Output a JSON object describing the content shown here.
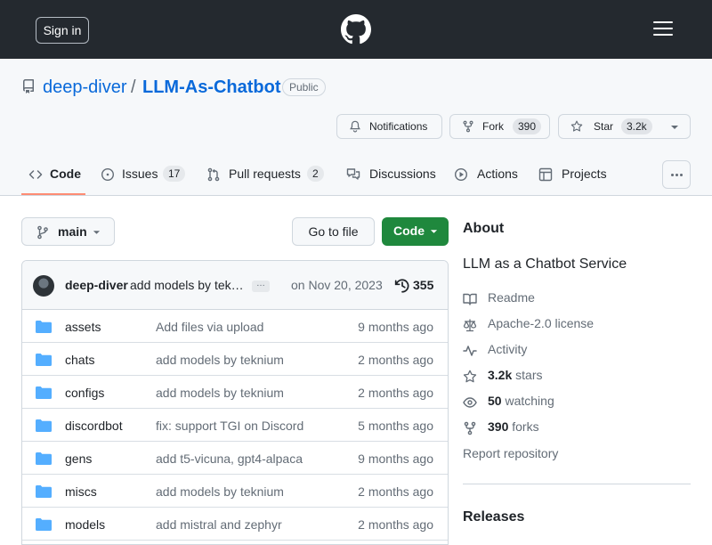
{
  "header": {
    "sign_in_label": "Sign in"
  },
  "repo": {
    "owner": "deep-diver",
    "separator": "/",
    "name": "LLM-As-Chatbot",
    "visibility": "Public",
    "actions": {
      "notifications_label": "Notifications",
      "fork_label": "Fork",
      "fork_count": "390",
      "star_label": "Star",
      "star_count": "3.2k"
    }
  },
  "tabs": [
    {
      "label": "Code",
      "count": null,
      "icon": "code-icon",
      "selected": true
    },
    {
      "label": "Issues",
      "count": "17",
      "icon": "issue-icon"
    },
    {
      "label": "Pull requests",
      "count": "2",
      "icon": "pull-request-icon"
    },
    {
      "label": "Discussions",
      "count": null,
      "icon": "discussion-icon"
    },
    {
      "label": "Actions",
      "count": null,
      "icon": "play-icon"
    },
    {
      "label": "Projects",
      "count": null,
      "icon": "table-icon"
    }
  ],
  "toolbar": {
    "branch": "main",
    "go_to_file": "Go to file",
    "code_button": "Code"
  },
  "latest_commit": {
    "author": "deep-diver",
    "message": "add models by tek…",
    "ellipsis": "…",
    "date": "on Nov 20, 2023",
    "commit_count": "355"
  },
  "files": [
    {
      "name": "assets",
      "message": "Add files via upload",
      "date": "9 months ago"
    },
    {
      "name": "chats",
      "message": "add models by teknium",
      "date": "2 months ago"
    },
    {
      "name": "configs",
      "message": "add models by teknium",
      "date": "2 months ago"
    },
    {
      "name": "discordbot",
      "message": "fix: support TGI on Discord",
      "date": "5 months ago"
    },
    {
      "name": "gens",
      "message": "add t5-vicuna, gpt4-alpaca",
      "date": "9 months ago"
    },
    {
      "name": "miscs",
      "message": "add models by teknium",
      "date": "2 months ago"
    },
    {
      "name": "models",
      "message": "add mistral and zephyr",
      "date": "2 months ago"
    }
  ],
  "about": {
    "heading": "About",
    "description": "LLM as a Chatbot Service",
    "readme": "Readme",
    "license": "Apache-2.0 license",
    "activity": "Activity",
    "stars_count": "3.2k",
    "stars_label": "stars",
    "watching_count": "50",
    "watching_label": "watching",
    "forks_count": "390",
    "forks_label": "forks",
    "report": "Report repository"
  },
  "releases": {
    "heading": "Releases"
  },
  "colors": {
    "header_bg": "#24292f",
    "link": "#0969da",
    "code_button": "#1f883d",
    "tab_underline": "#fd8c73",
    "folder": "#54aeff"
  }
}
